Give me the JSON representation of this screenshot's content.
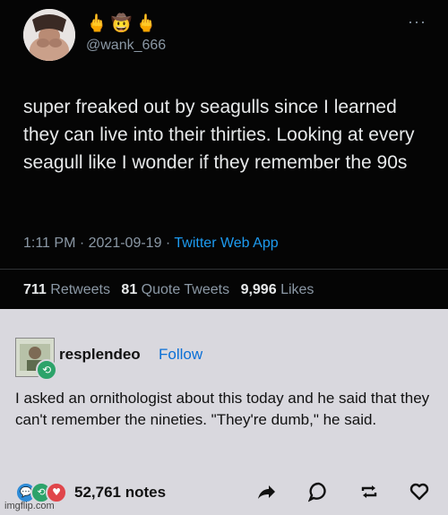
{
  "tweet": {
    "emojis": [
      "🖕",
      "🤠",
      "🖕"
    ],
    "handle": "@wank_666",
    "more_label": "···",
    "text": "super freaked out by seagulls since I learned they can live into their thirties. Looking at every seagull like I wonder if they remember the 90s",
    "time": "1:11 PM",
    "date": "2021-09-19",
    "separator": " · ",
    "app": "Twitter Web App",
    "retweets_count": "711",
    "retweets_label": "Retweets",
    "quotes_count": "81",
    "quotes_label": "Quote Tweets",
    "likes_count": "9,996",
    "likes_label": "Likes"
  },
  "tumblr": {
    "username": "resplendeo",
    "follow_label": "Follow",
    "body": "I asked an ornithologist about this today and he said that they can't remember the nineties. \"They're dumb,\" he said.",
    "notes": "52,761 notes",
    "note_icons": [
      {
        "name": "reply-note-icon",
        "color": "#2e8bd6"
      },
      {
        "name": "reblog-note-icon",
        "color": "#2ca36a"
      },
      {
        "name": "like-note-icon",
        "color": "#e0464b"
      }
    ],
    "actions": [
      "share-icon",
      "reply-icon",
      "reblog-icon",
      "like-icon"
    ]
  },
  "watermark": "imgflip.com",
  "colors": {
    "twitter_bg": "#050505",
    "twitter_link": "#1d9bf0",
    "tumblr_bg": "#d9d8de",
    "tumblr_follow": "#0a6fd6"
  }
}
